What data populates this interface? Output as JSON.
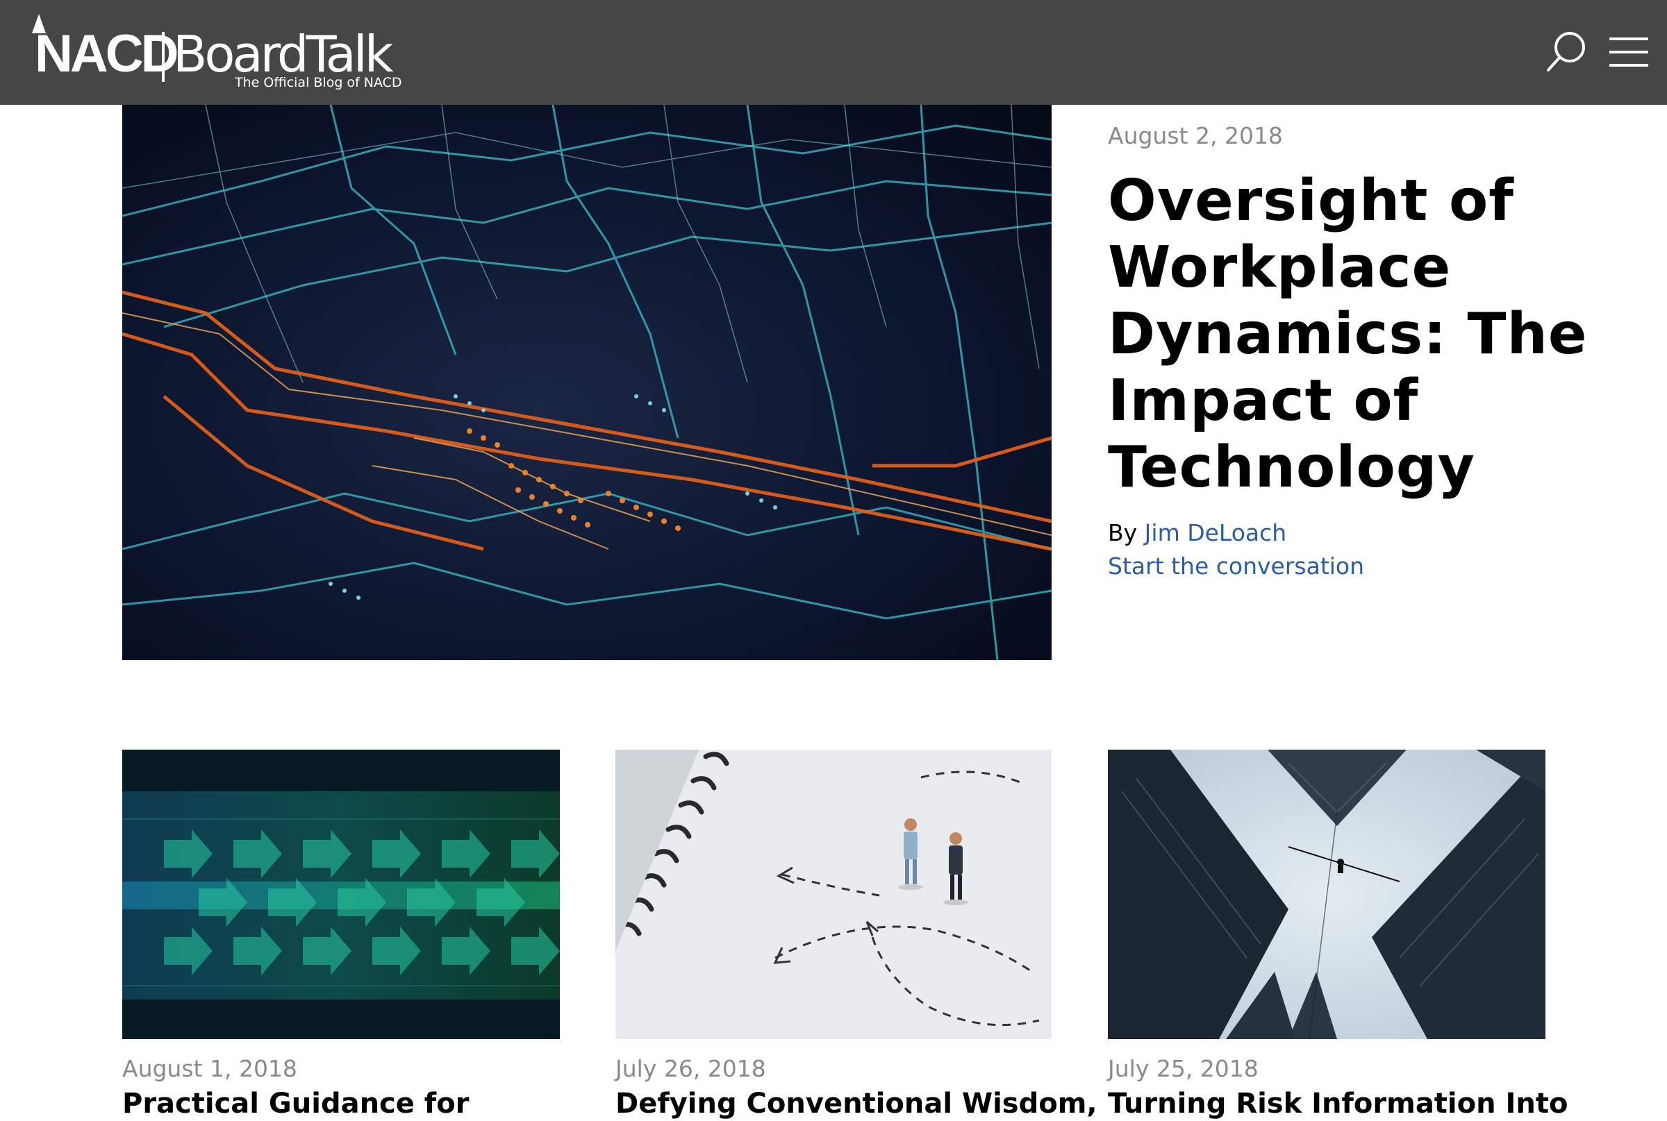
{
  "colors": {
    "header_bg": "#464646",
    "link": "#2b5ca8",
    "date": "#8a8a8a"
  },
  "header": {
    "logo_primary": "NACD",
    "logo_secondary": "BoardTalk",
    "tagline": "The Official Blog of NACD",
    "icons": [
      "search-icon",
      "hamburger-menu-icon"
    ]
  },
  "featured": {
    "date": "August 2, 2018",
    "title": "Oversight of Workplace Dynamics: The Impact of Technology",
    "by_prefix": "By ",
    "author": "Jim DeLoach",
    "comments_link": "Start the conversation"
  },
  "cards": [
    {
      "date": "August 1, 2018",
      "title": "Practical Guidance for"
    },
    {
      "date": "July 26, 2018",
      "title": "Defying Conventional Wisdom,"
    },
    {
      "date": "July 25, 2018",
      "title": "Turning Risk Information Into"
    }
  ]
}
